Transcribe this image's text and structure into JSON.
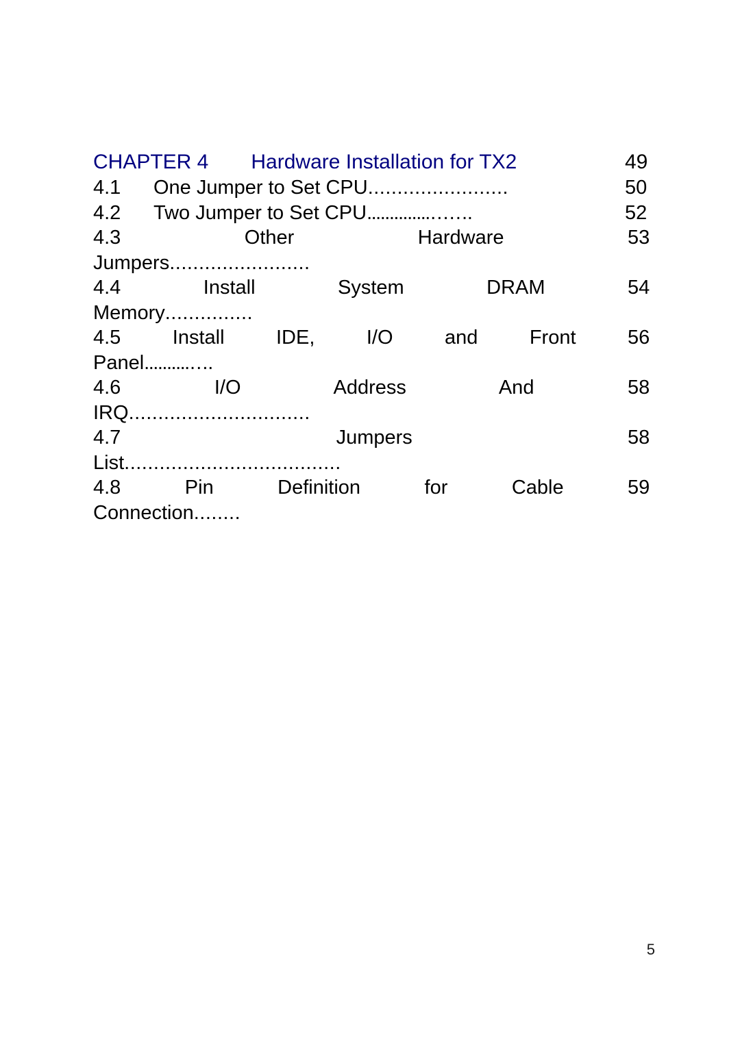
{
  "document": {
    "page_number": "5",
    "heading_color": "#000080",
    "body_color": "#000000"
  },
  "toc": {
    "chapter": {
      "label": "CHAPTER 4",
      "title": "Hardware Installation for TX2",
      "page": "49"
    },
    "entries": [
      {
        "number": "4.1",
        "title": "One Jumper to Set CPU",
        "leader": "........................",
        "page": "50",
        "layout": "natural",
        "continuation": "",
        "continuation_leader": ""
      },
      {
        "number": "4.2",
        "title": "Two Jumper to Set CPU",
        "leader": "..............…….",
        "page": "52",
        "layout": "natural",
        "continuation": "",
        "continuation_leader": ""
      },
      {
        "number": "4.3",
        "title_words": [
          "Other",
          "Hardware"
        ],
        "page": "53",
        "layout": "justified",
        "continuation": "Jumpers",
        "continuation_leader": "........................"
      },
      {
        "number": "4.4",
        "title_words": [
          "Install",
          "System",
          "DRAM"
        ],
        "page": "54",
        "layout": "justified",
        "continuation": "Memory",
        "continuation_leader": "..............."
      },
      {
        "number": "4.5",
        "title_words": [
          "Install",
          "IDE,",
          "I/O",
          "and",
          "Front"
        ],
        "page": "56",
        "layout": "justified",
        "continuation": "Panel",
        "continuation_leader": "..........…."
      },
      {
        "number": "4.6",
        "title_words": [
          "I/O",
          "Address",
          "And"
        ],
        "page": "58",
        "layout": "justified",
        "continuation": "IRQ",
        "continuation_leader": "..............................."
      },
      {
        "number": "4.7",
        "title_words": [
          "Jumpers"
        ],
        "page": "58",
        "layout": "justified",
        "continuation": "List",
        "continuation_leader": "....................................."
      },
      {
        "number": "4.8",
        "title_words": [
          "Pin",
          "Definition",
          "for",
          "Cable"
        ],
        "page": "59",
        "layout": "justified",
        "continuation": "Connection",
        "continuation_leader": "........"
      }
    ]
  }
}
